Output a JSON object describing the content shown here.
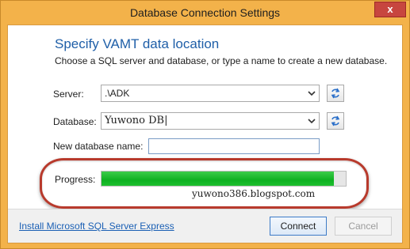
{
  "window": {
    "title": "Database Connection Settings",
    "close_glyph": "x"
  },
  "main": {
    "heading": "Specify VAMT data location",
    "subtext": "Choose a SQL server and database, or type a name to create a new database.",
    "server": {
      "label": "Server:",
      "value": ".\\ADK"
    },
    "database": {
      "label": "Database:",
      "value": "Yuwono DB|"
    },
    "new_db": {
      "label": "New database name:",
      "value": ""
    },
    "progress": {
      "label": "Progress:",
      "fraction": 0.95
    },
    "watermark": "yuwono386.blogspot.com",
    "highlight_color": "#b83a2c"
  },
  "footer": {
    "link": "Install Microsoft SQL Server Express",
    "connect_label": "Connect",
    "cancel_label": "Cancel"
  },
  "icons": [
    "close-icon",
    "dropdown-arrow-icon",
    "refresh-icon"
  ]
}
